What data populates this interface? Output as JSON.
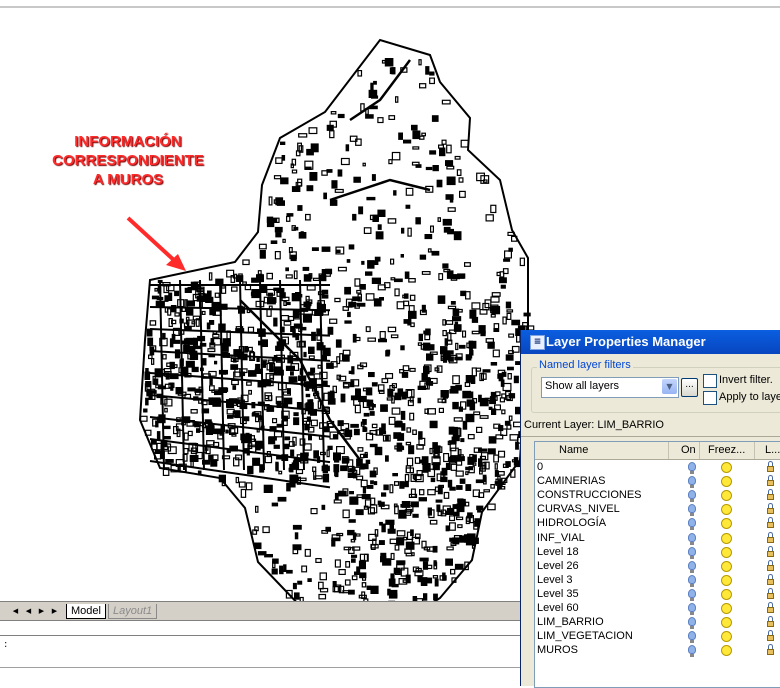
{
  "annotation": {
    "lines": [
      "INFORMACIÓN",
      "CORRESPONDIENTE",
      "A MUROS"
    ],
    "color": "#ff2a2a"
  },
  "layout_tabs": {
    "tabs": [
      "Model",
      "Layout1"
    ],
    "active": "Model"
  },
  "command_line": {
    "prompt": ":"
  },
  "layer_dialog": {
    "title": "Layer Properties Manager",
    "title_icon": "layers-icon",
    "named_filters_label": "Named layer filters",
    "filter_value": "Show all layers",
    "dots_button": "...",
    "invert_filter_label": "Invert filter.",
    "apply_to_layers_label": "Apply to layers",
    "current_layer": "Current Layer:  LIM_BARRIO",
    "columns": [
      "Name",
      "On",
      "Freez...",
      "L..."
    ],
    "rows": [
      {
        "name": "0"
      },
      {
        "name": "CAMINERIAS"
      },
      {
        "name": "CONSTRUCCIONES"
      },
      {
        "name": "CURVAS_NIVEL"
      },
      {
        "name": "HIDROLOGÍA"
      },
      {
        "name": "INF_VIAL"
      },
      {
        "name": "Level 18"
      },
      {
        "name": "Level 26"
      },
      {
        "name": "Level 3"
      },
      {
        "name": "Level 35"
      },
      {
        "name": "Level 60"
      },
      {
        "name": "LIM_BARRIO"
      },
      {
        "name": "LIM_VEGETACION"
      },
      {
        "name": "MUROS"
      }
    ]
  },
  "colors": {
    "titlebar": "#0a5fe0",
    "dialog_bg": "#ece9d8",
    "arrow": "#ff2a2a"
  }
}
